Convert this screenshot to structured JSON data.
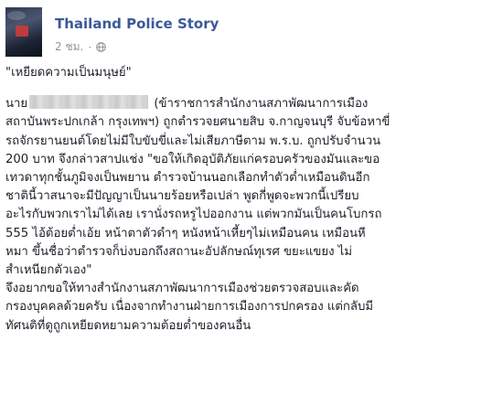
{
  "header": {
    "page_name": "Thailand Police Story",
    "time": "2 ชม.",
    "separator": "·",
    "privacy_icon": "globe-icon"
  },
  "post": {
    "lines": [
      "\"เหยียดความเป็นมนุษย์\"",
      "",
      "(ข้าราชการสำนักงานสภาพัฒนาการเมือง",
      "สถาบันพระปกเกล้า กรุงเทพฯ) ถูกตำรวจยศนายสิบ จ.กาญจนบุรี จับข้อหาขี่",
      "รถจักรยานยนต์โดยไม่มีใบขับขี่และไม่เสียภาษีตาม พ.ร.บ. ถูกปรับจำนวน",
      "200 บาท จึงกล่าวสาปแช่ง \"ขอให้เกิดอุบัติภัยแก่ครอบครัวของมันและขอ",
      "เทวดาทุกชั้นภูมิจงเป็นพยาน ตำรวจบ้านนอกเลือกทำตัวต่ำเหมือนดินอีก",
      "ชาตินี้วาสนาจะมีปัญญาเป็นนายร้อยหรือเปล่า พูดกี่พูดจะพวกนี้เปรียบ",
      "อะไรกับพวกเราไม่ได้เลย เรานั่งรถหรูไปออกงาน แต่พวกมันเป็นคนโบกรถ",
      "555 ไอ้ต้อยต่ำเอ้ย หน้าตาตัวดำๆ หนังหน้าเหี้ยๆไม่เหมือนคน เหมือนหี",
      "หมา ขึ้นชื่อว่าตำรวจก็บ่งบอกถึงสถานะอัปลักษณ์ทุเรศ ขยะแขยง ไม่",
      "สำเหนียกตัวเอง\"",
      "จึงอยากขอให้ทางสำนักงานสภาพัฒนาการเมืองช่วยตรวจสอบและคัด",
      "กรองบุคคลด้วยครับ เนื่องจากทำงานฝ่ายการเมืองการปกครอง แต่กลับมี",
      "ทัศนติที่ดูถูกเหยียดหยามความต้อยต่ำของคนอื่น"
    ],
    "name_prefix": "นาย"
  },
  "colors": {
    "page_name": "#3b5998",
    "meta": "#90949c",
    "text": "#1d2129"
  }
}
